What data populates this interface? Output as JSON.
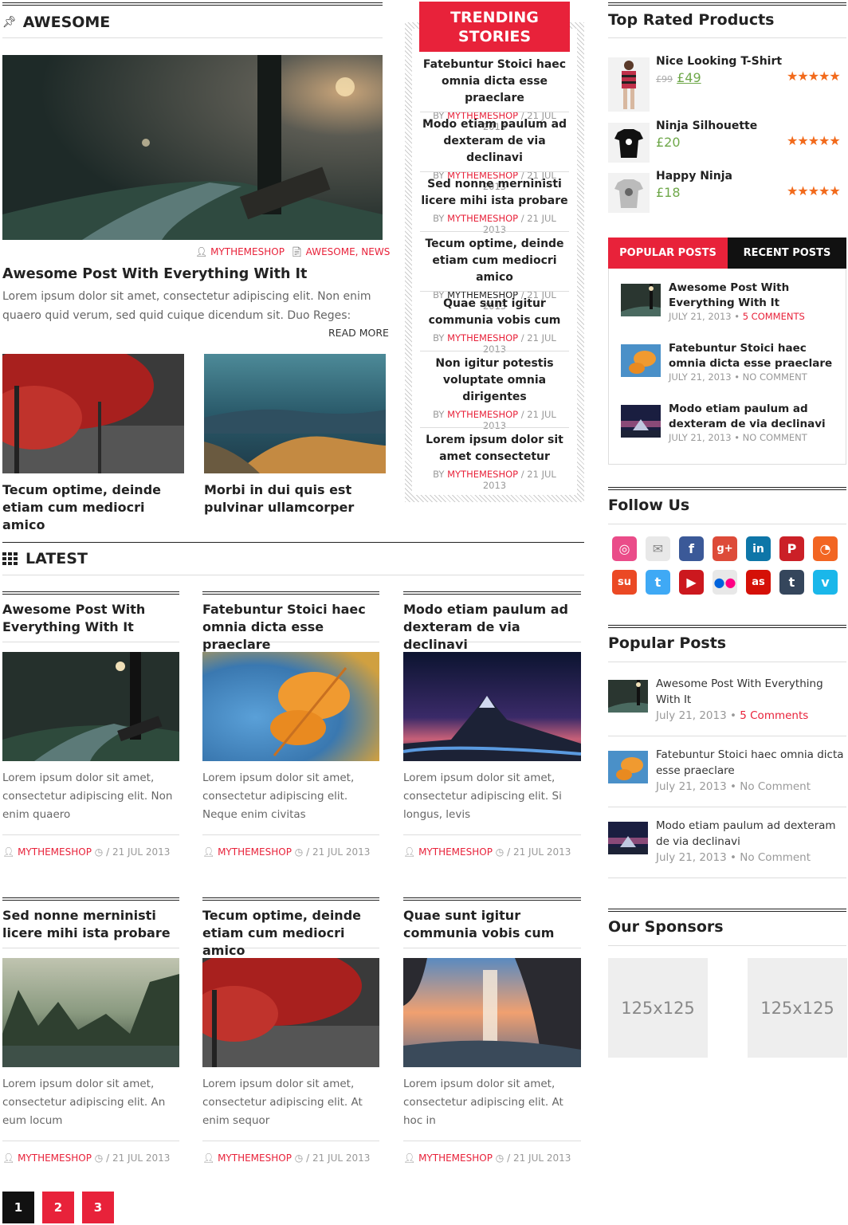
{
  "awesome": {
    "title": "AWESOME",
    "author": "MYTHEMESHOP",
    "categories": "AWESOME, NEWS",
    "post_title": "Awesome Post With Everything With It",
    "excerpt": "Lorem ipsum dolor sit amet, consectetur adipiscing elit. Non enim quaero quid verum, sed quid cuique dicendum sit. Duo Reges:",
    "read_more": "READ MORE",
    "small_posts": [
      {
        "title": "Tecum optime, deinde etiam cum mediocri amico"
      },
      {
        "title": "Morbi in dui quis est pulvinar ullamcorper"
      }
    ]
  },
  "trending": {
    "title_1": "TRENDING",
    "title_2": "STORIES",
    "by": "BY",
    "items": [
      {
        "title": "Fatebuntur Stoici haec omnia dicta esse praeclare",
        "author": "MYTHEMESHOP",
        "date": "/ 21 JUL 2013"
      },
      {
        "title": "Modo etiam paulum ad dexteram de via declinavi",
        "author": "MYTHEMESHOP",
        "date": "/ 21 JUL 2013"
      },
      {
        "title": "Sed nonne merninisti licere mihi ista probare",
        "author": "MYTHEMESHOP",
        "date": "/ 21 JUL 2013"
      },
      {
        "title": "Tecum optime, deinde etiam cum mediocri amico",
        "author": "MYTHEMESHOP",
        "date": "/ 21 JUL 2013"
      },
      {
        "title": "Quae sunt igitur communia vobis cum",
        "author": "MYTHEMESHOP",
        "date": "/ 21 JUL 2013"
      },
      {
        "title": "Non igitur potestis voluptate omnia dirigentes",
        "author": "MYTHEMESHOP",
        "date": "/ 21 JUL 2013"
      },
      {
        "title": "Lorem ipsum dolor sit amet consectetur",
        "author": "MYTHEMESHOP",
        "date": "/ 21 JUL 2013"
      }
    ]
  },
  "latest": {
    "title": "LATEST",
    "posts": [
      {
        "title": "Awesome Post With Everything With It",
        "excerpt": "Lorem ipsum dolor sit amet, consectetur adipiscing elit. Non enim quaero",
        "author": "MYTHEMESHOP",
        "date": "/ 21 JUL 2013"
      },
      {
        "title": "Fatebuntur Stoici haec omnia dicta esse praeclare",
        "excerpt": "Lorem ipsum dolor sit amet, consectetur adipiscing elit. Neque enim civitas",
        "author": "MYTHEMESHOP",
        "date": "/ 21 JUL 2013"
      },
      {
        "title": "Modo etiam paulum ad dexteram de via declinavi",
        "excerpt": "Lorem ipsum dolor sit amet, consectetur adipiscing elit. Si longus, levis",
        "author": "MYTHEMESHOP",
        "date": "/ 21 JUL 2013"
      },
      {
        "title": "Sed nonne merninisti licere mihi ista probare",
        "excerpt": "Lorem ipsum dolor sit amet, consectetur adipiscing elit. An eum locum",
        "author": "MYTHEMESHOP",
        "date": "/ 21 JUL 2013"
      },
      {
        "title": "Tecum optime, deinde etiam cum mediocri amico",
        "excerpt": "Lorem ipsum dolor sit amet, consectetur adipiscing elit. At enim sequor",
        "author": "MYTHEMESHOP",
        "date": "/ 21 JUL 2013"
      },
      {
        "title": "Quae sunt igitur communia vobis cum",
        "excerpt": "Lorem ipsum dolor sit amet, consectetur adipiscing elit. At hoc in",
        "author": "MYTHEMESHOP",
        "date": "/ 21 JUL 2013"
      }
    ]
  },
  "pagination": [
    "1",
    "2",
    "3"
  ],
  "top_rated": {
    "title": "Top Rated Products",
    "products": [
      {
        "name": "Nice Looking T-Shirt",
        "old_price": "£99",
        "price": "£49",
        "stars": "★★★★★"
      },
      {
        "name": "Ninja Silhouette",
        "price": "£20",
        "stars": "★★★★★"
      },
      {
        "name": "Happy Ninja",
        "price": "£18",
        "stars": "★★★★★"
      }
    ]
  },
  "tabs": {
    "popular_label": "POPULAR POSTS",
    "recent_label": "RECENT POSTS",
    "items": [
      {
        "title": "Awesome Post With Everything With It",
        "date": "JULY 21, 2013 •",
        "comments": "5 COMMENTS"
      },
      {
        "title": "Fatebuntur Stoici haec omnia dicta esse praeclare",
        "date": "JULY 21, 2013 • NO COMMENT"
      },
      {
        "title": "Modo etiam paulum ad dexteram de via declinavi",
        "date": "JULY 21, 2013 • NO COMMENT"
      }
    ]
  },
  "follow": {
    "title": "Follow Us",
    "icons": [
      "dribbble-icon",
      "email-icon",
      "facebook-icon",
      "googleplus-icon",
      "linkedin-icon",
      "pinterest-icon",
      "rss-icon",
      "stumbleupon-icon",
      "twitter-icon",
      "youtube-icon",
      "flickr-icon",
      "lastfm-icon",
      "tumblr-icon",
      "vimeo-icon"
    ]
  },
  "popular": {
    "title": "Popular Posts",
    "items": [
      {
        "title": "Awesome Post With Everything With It",
        "date": "July 21, 2013 •",
        "comments": "5 Comments"
      },
      {
        "title": "Fatebuntur Stoici haec omnia dicta esse praeclare",
        "date": "July 21, 2013 • No Comment"
      },
      {
        "title": "Modo etiam paulum ad dexteram de via declinavi",
        "date": "July 21, 2013 • No Comment"
      }
    ]
  },
  "sponsors": {
    "title": "Our Sponsors",
    "ads": [
      "125x125",
      "125x125"
    ]
  },
  "colors": {
    "accent": "#e8223a",
    "dark": "#111111",
    "price": "#6fa84a",
    "stars": "#f26a1b"
  }
}
